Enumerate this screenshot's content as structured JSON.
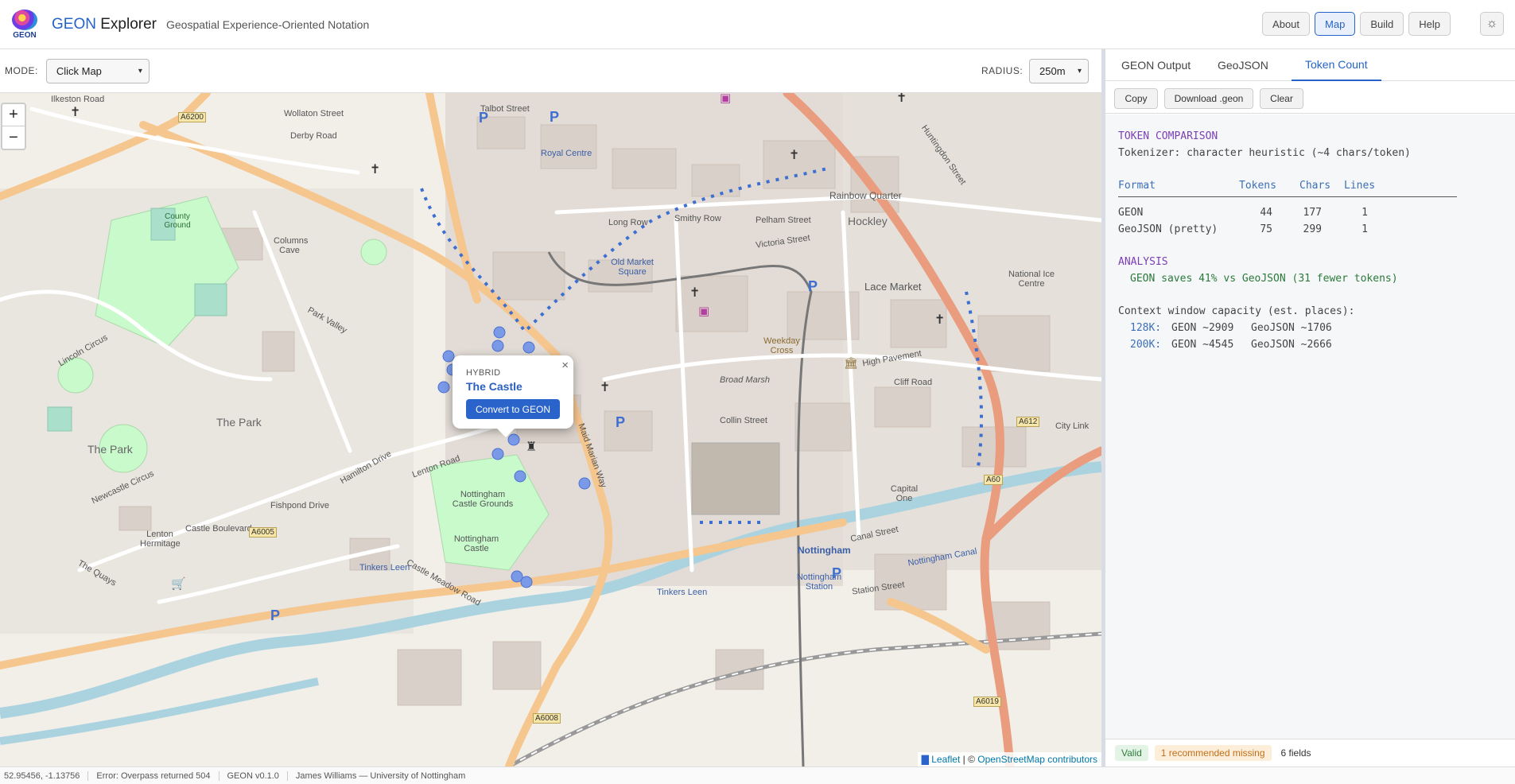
{
  "header": {
    "logo_text": "GEON",
    "brand_geon": "GEON",
    "brand_explorer": "Explorer",
    "tagline": "Geospatial Experience-Oriented Notation",
    "nav": [
      "About",
      "Map",
      "Build",
      "Help"
    ],
    "active_nav": "Map",
    "theme_icon": "sun-icon"
  },
  "toolbar": {
    "mode_label": "MODE:",
    "mode_value": "Click Map",
    "radius_label": "RADIUS:",
    "radius_value": "250m"
  },
  "map": {
    "zoom_in": "+",
    "zoom_out": "−",
    "labels": {
      "park_big": "The Park",
      "park_big2": "The Park",
      "castle_grounds": "Nottingham Castle Grounds",
      "castle": "Nottingham Castle",
      "hockley": "Hockley",
      "rainbow": "Rainbow Quarter",
      "lace_market": "Lace Market",
      "old_market": "Old Market Square",
      "royal_centre": "Royal Centre",
      "nottingham": "Nottingham",
      "capital_one": "Capital One",
      "weekday_cross": "Weekday Cross",
      "nottingham_station": "Nottingham Station",
      "national_ice": "National Ice Centre",
      "columns_cave": "Columns Cave",
      "county_ground": "County Ground",
      "lenton_hermitage": "Lenton Hermitage",
      "ilkeston_road": "Ilkeston Road",
      "derby_road": "Derby Road",
      "wollaton_street": "Wollaton Street",
      "castle_boulevard": "Castle Boulevard",
      "a6200": "A6200",
      "a6005": "A6005",
      "a6008": "A6008",
      "a6019": "A6019",
      "a612": "A612",
      "a60": "A60",
      "huntingdon_street": "Huntingdon Street",
      "lenton_road": "Lenton Road",
      "maid_marian_way": "Maid Marian Way",
      "canal_street": "Canal Street",
      "station_street": "Station Street",
      "tinkers_leen": "Tinkers Leen",
      "tinkers_leen2": "Tinkers Leen",
      "nottingham_canal": "Nottingham Canal",
      "long_row": "Long Row",
      "pelham_street": "Pelham Street",
      "high_pavement": "High Pavement",
      "park_valley": "Park Valley",
      "lincoln_circus": "Lincoln Circus",
      "newcastle_circus": "Newcastle Circus",
      "talbot_street": "Talbot Street",
      "victoria_street": "Victoria Street",
      "smithy_row": "Smithy Row",
      "collin_street": "Collin Street",
      "broad_marsh": "Broad Marsh",
      "cliff_road": "Cliff Road",
      "city_link": "City Link",
      "the_quays": "The Quays",
      "castle_meadow_road": "Castle Meadow Road",
      "hamilton_drive": "Hamilton Drive",
      "fishpond_drive": "Fishpond Drive"
    },
    "popup": {
      "type": "HYBRID",
      "name": "The Castle",
      "button": "Convert to GEON",
      "close": "×"
    },
    "attribution_leaflet": "Leaflet",
    "attribution_sep": " | © ",
    "attribution_osm": "OpenStreetMap contributors"
  },
  "panel": {
    "tabs": [
      "GEON Output",
      "GeoJSON",
      "Token Count"
    ],
    "active_tab": "Token Count",
    "actions": [
      "Copy",
      "Download .geon",
      "Clear"
    ],
    "output": {
      "title": "TOKEN COMPARISON",
      "tokenizer": "Tokenizer: character heuristic (~4 chars/token)",
      "headers": [
        "Format",
        "Tokens",
        "Chars",
        "Lines"
      ],
      "rows": [
        {
          "format": "GEON",
          "tokens": "44",
          "chars": "177",
          "lines": "1"
        },
        {
          "format": "GeoJSON (pretty)",
          "tokens": "75",
          "chars": "299",
          "lines": "1"
        }
      ],
      "analysis_title": "ANALYSIS",
      "analysis_text": "GEON saves 41% vs GeoJSON (31 fewer tokens)",
      "context_title": "Context window capacity (est. places):",
      "context_rows": [
        {
          "label": "128K:",
          "geon": "GEON ~2909",
          "geojson": "GeoJSON ~1706"
        },
        {
          "label": "200K:",
          "geon": "GEON ~4545",
          "geojson": "GeoJSON ~2666"
        }
      ]
    },
    "status": {
      "valid": "Valid",
      "warning": "1 recommended missing",
      "fields": "6 fields"
    }
  },
  "footer": {
    "coords": "52.95456, -1.13756",
    "error": "Error: Overpass returned 504",
    "version": "GEON v0.1.0",
    "author": "James Williams — University of Nottingham"
  },
  "colors": {
    "accent": "#2563c8",
    "primary_road": "#f6c68f",
    "trunk_road": "#e99c7e",
    "water": "#aad3df",
    "park": "#c8facc",
    "building": "#d9d0c9",
    "popup_button": "#2a63c9"
  }
}
